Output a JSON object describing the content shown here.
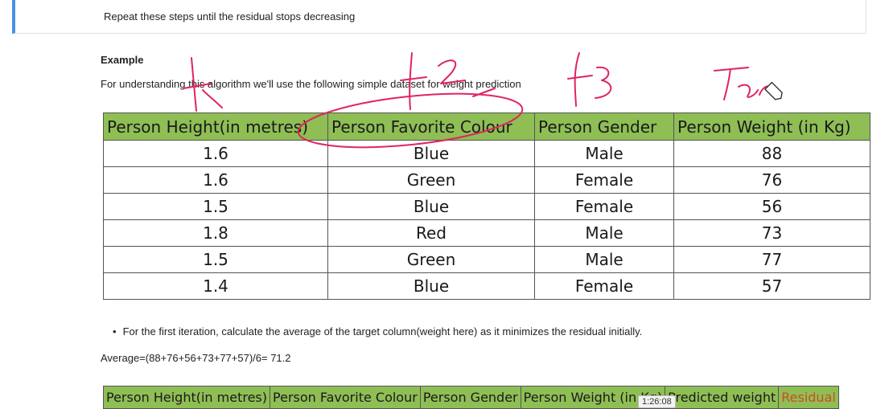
{
  "top_step": {
    "text": "Repeat these steps until the residual stops decreasing"
  },
  "example": {
    "title": "Example",
    "intro": "For understanding this algorithm we'll use the following simple dataset for weight prediction"
  },
  "table1": {
    "headers": [
      "Person Height(in metres)",
      "Person Favorite Colour",
      "Person Gender",
      "Person Weight (in Kg)"
    ],
    "rows": [
      [
        "1.6",
        "Blue",
        "Male",
        "88"
      ],
      [
        "1.6",
        "Green",
        "Female",
        "76"
      ],
      [
        "1.5",
        "Blue",
        "Female",
        "56"
      ],
      [
        "1.8",
        "Red",
        "Male",
        "73"
      ],
      [
        "1.5",
        "Green",
        "Male",
        "77"
      ],
      [
        "1.4",
        "Blue",
        "Female",
        "57"
      ]
    ]
  },
  "bullet": {
    "text": "For the first iteration, calculate the average of the target column(weight here) as it minimizes the residual initially."
  },
  "average": {
    "text": "Average=(88+76+56+73+77+57)/6= 71.2"
  },
  "table2": {
    "headers": [
      "Person Height(in metres)",
      "Person Favorite Colour",
      "Person Gender",
      "Person Weight (in Kg)",
      "Predicted weight",
      "Residual"
    ]
  },
  "video": {
    "timestamp": "1:26:08"
  },
  "annotations": {
    "f1": "f1",
    "f2": "f2",
    "f3": "f3",
    "tar": "Tar"
  },
  "colors": {
    "header_green": "#8fbe55",
    "ink_pink": "#e0245e",
    "residual_red": "#d04a2a",
    "accent_blue": "#4a90e2"
  }
}
